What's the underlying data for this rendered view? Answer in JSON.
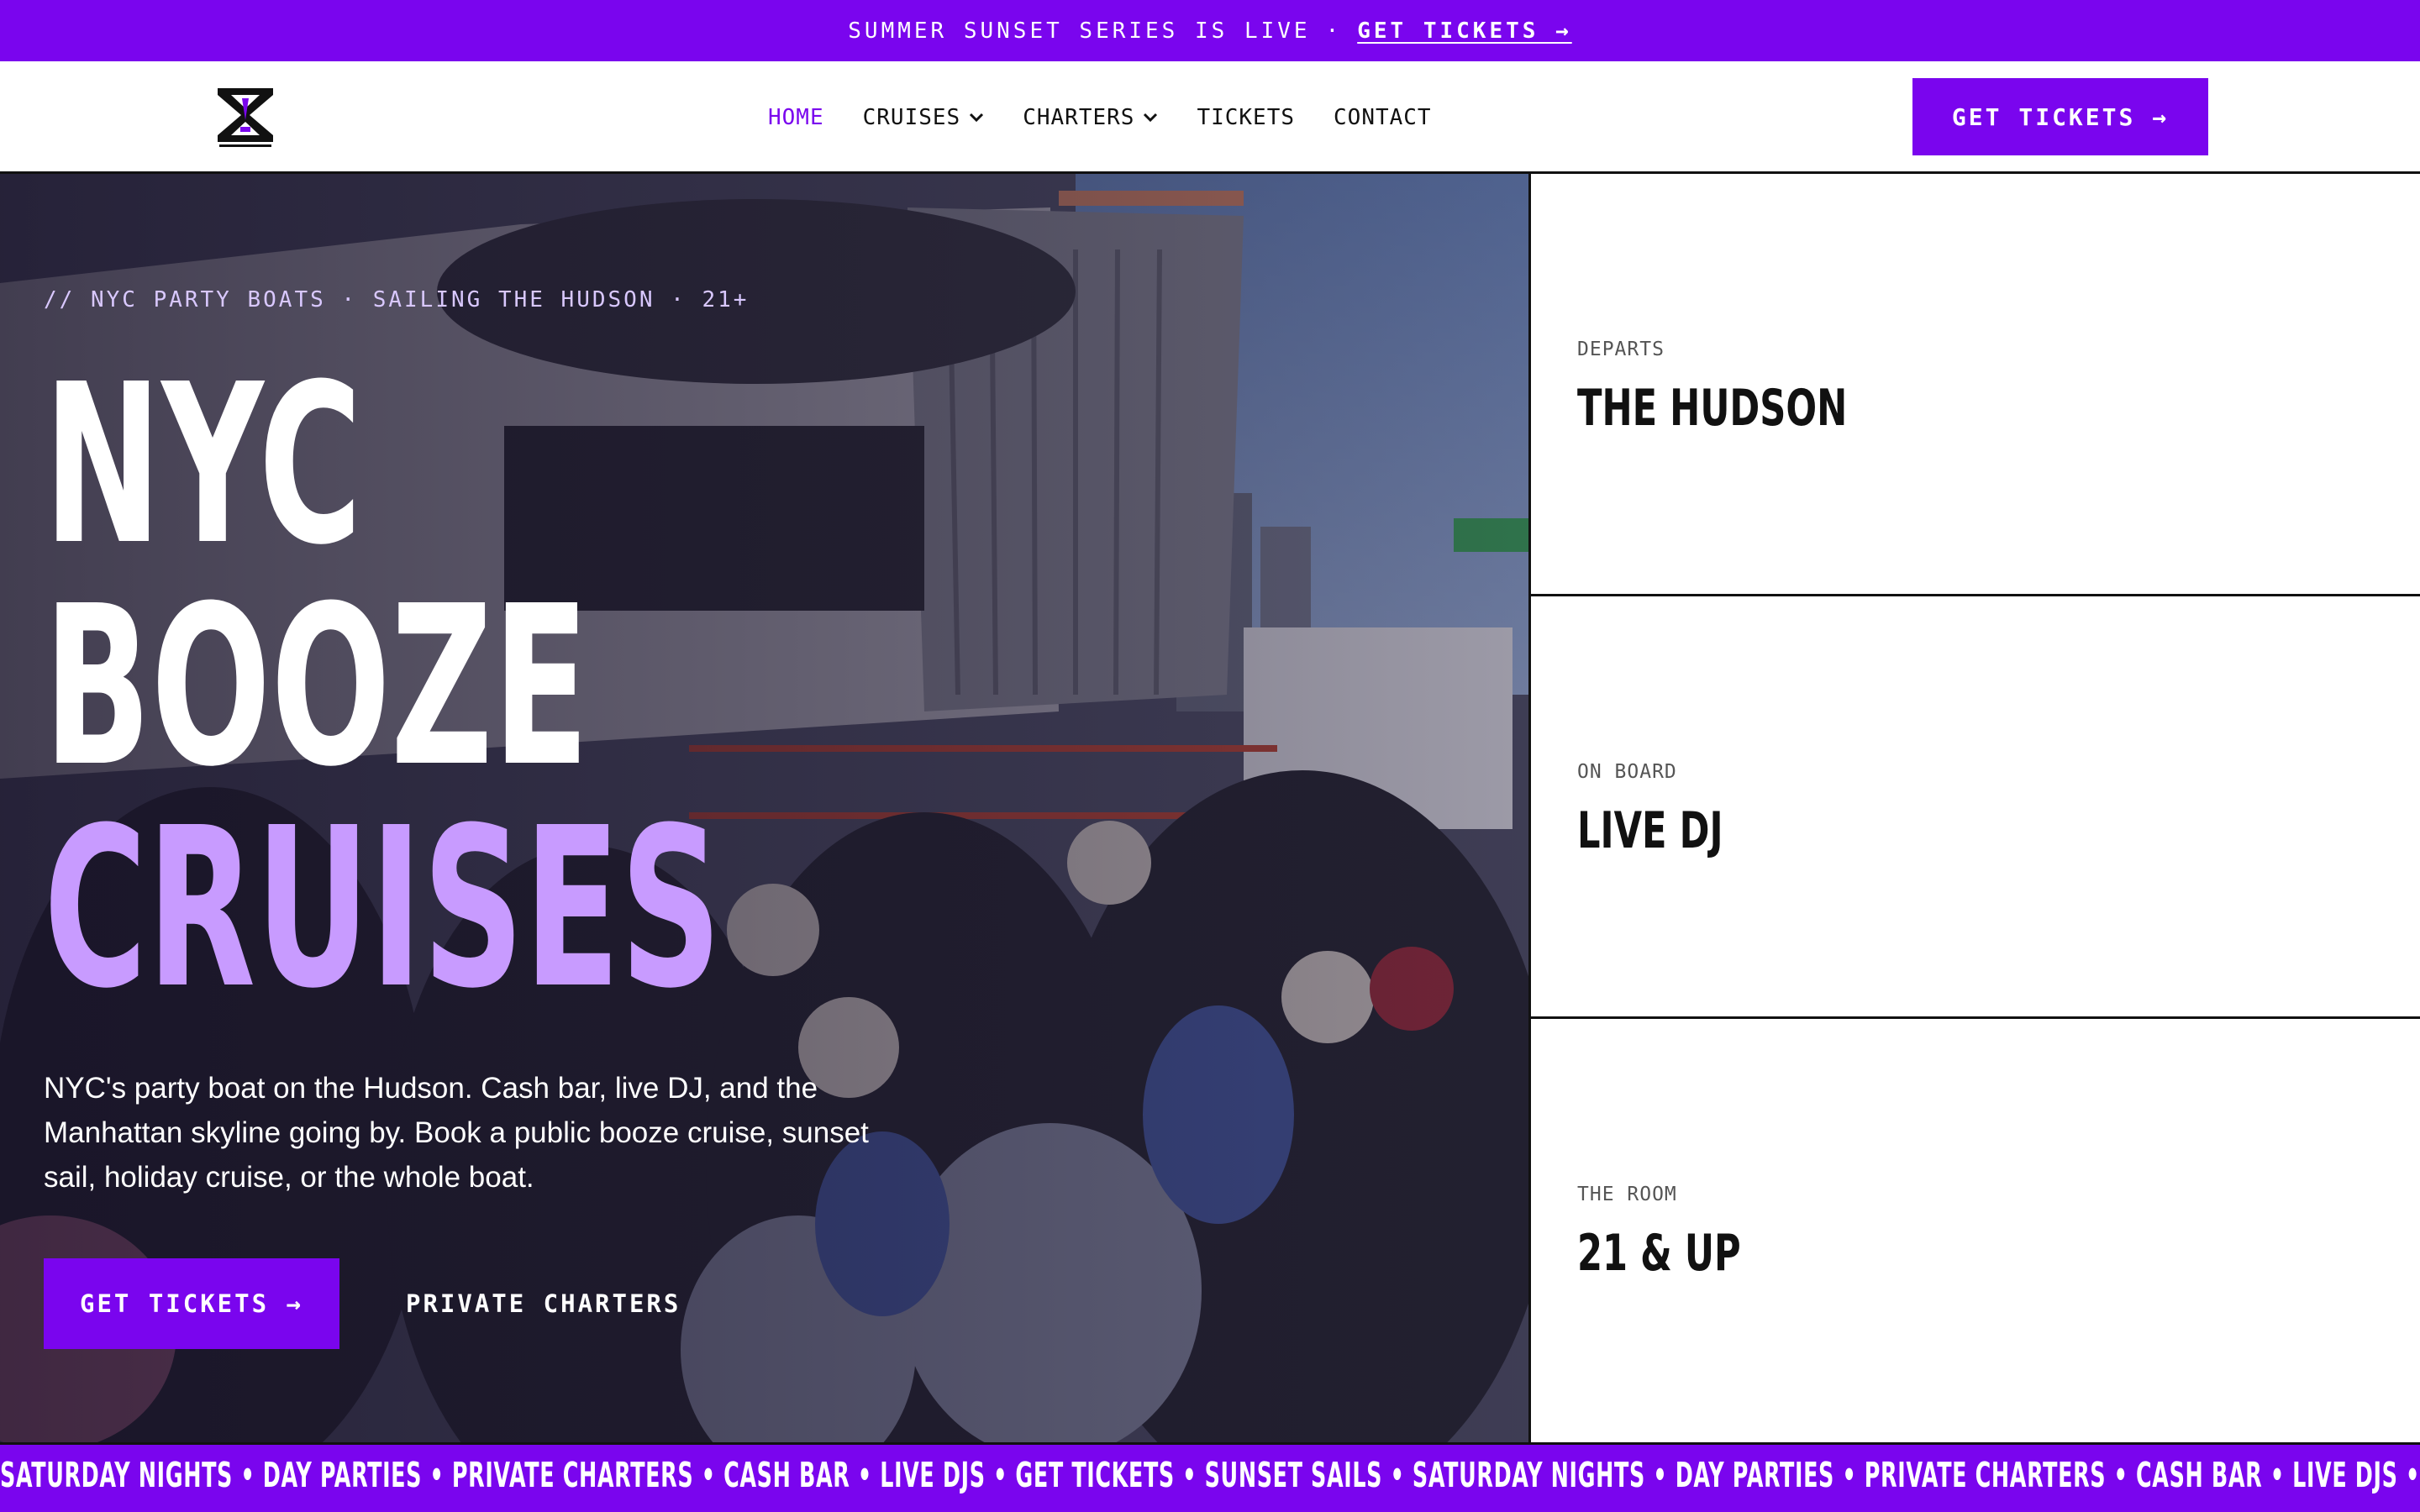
{
  "announcement": {
    "text": "SUMMER SUNSET SERIES IS LIVE",
    "separator": "·",
    "cta": "GET TICKETS →"
  },
  "nav": {
    "logo_icon": "hourglass-x-logo",
    "links": [
      {
        "label": "HOME",
        "active": true
      },
      {
        "label": "CRUISES",
        "dropdown": true
      },
      {
        "label": "CHARTERS",
        "dropdown": true
      },
      {
        "label": "TICKETS"
      },
      {
        "label": "CONTACT"
      }
    ],
    "cta": "GET TICKETS →"
  },
  "hero": {
    "eyebrow": "// NYC PARTY BOATS · SAILING THE HUDSON · 21+",
    "headline_line1": "NYC",
    "headline_line2": "BOOZE",
    "headline_line3": "CRUISES",
    "description": "NYC's party boat on the Hudson. Cash bar, live DJ, and the Manhattan skyline going by. Book a public booze cruise, sunset sail, holiday cruise, or the whole boat.",
    "primary_cta": "GET TICKETS →",
    "secondary_cta": "PRIVATE CHARTERS"
  },
  "cards": [
    {
      "label": "DEPARTS",
      "value": "THE HUDSON"
    },
    {
      "label": "ON BOARD",
      "value": "LIVE DJ"
    },
    {
      "label": "THE ROOM",
      "value": "21 & UP"
    }
  ],
  "ticker": {
    "text": "SATURDAY NIGHTS • DAY PARTIES • PRIVATE CHARTERS • CASH BAR • LIVE DJS •  GET TICKETS • SUNSET SAILS • SATURDAY NIGHTS • DAY PARTIES • PRIVATE CHARTERS • CASH BAR • LIVE DJS •  GET TICKETS • SUNSET SAILS"
  },
  "colors": {
    "brand_purple": "#7a05ee",
    "accent_lavender": "#c89bff",
    "ink": "#111111"
  }
}
